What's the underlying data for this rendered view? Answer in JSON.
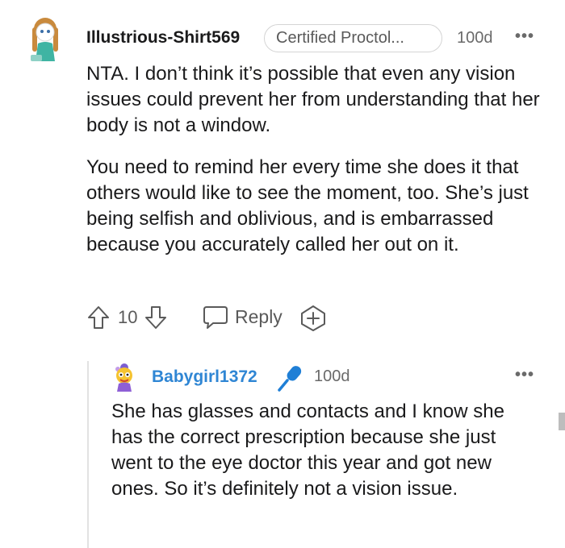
{
  "comment": {
    "username": "Illustrious-Shirt569",
    "flair": "Certified Proctol...",
    "age": "100d",
    "paragraphs": [
      "NTA. I don’t think it’s possible that even any vision issues could prevent her from understanding that her body is not a window.",
      "You need to remind her every time she does it that others would like to see the moment, too. She’s just being selfish and oblivious, and is embarrassed because you accurately called her out on it."
    ],
    "vote_count": "10",
    "reply_label": "Reply"
  },
  "reply": {
    "username": "Babygirl1372",
    "age": "100d",
    "text": "She has glasses and contacts and I know she has the correct prescription because she just went to the eye doctor this year and got new ones. So it’s definitely not a vision issue."
  },
  "icons": {
    "upvote": "upvote-arrow-icon",
    "downvote": "downvote-arrow-icon",
    "reply": "speech-bubble-icon",
    "award": "add-award-icon",
    "more": "more-options-icon",
    "verified": "microphone-icon"
  },
  "colors": {
    "reply_username": "#2f86d4",
    "mic_icon": "#1f7fd6",
    "text": "#1a1a1b",
    "muted": "#5a5a5a"
  }
}
